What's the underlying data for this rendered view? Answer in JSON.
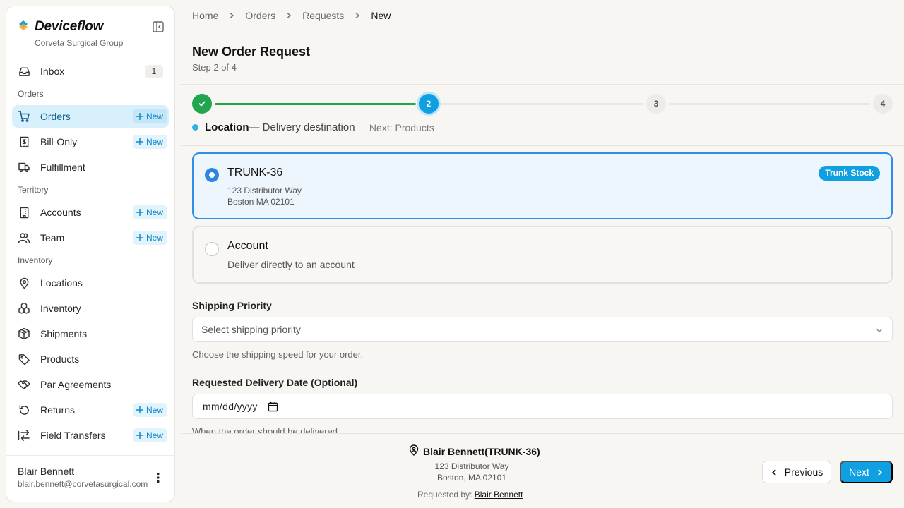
{
  "brand": {
    "name": "Deviceflow",
    "org": "Corveta Surgical Group",
    "accent": "#0ea0e0"
  },
  "sidebar": {
    "inbox": {
      "label": "Inbox",
      "count": "1"
    },
    "sections": {
      "orders": "Orders",
      "territory": "Territory",
      "inventory": "Inventory"
    },
    "new_label": "New",
    "items": {
      "orders": "Orders",
      "bill_only": "Bill-Only",
      "fulfillment": "Fulfillment",
      "accounts": "Accounts",
      "team": "Team",
      "locations": "Locations",
      "inventory": "Inventory",
      "shipments": "Shipments",
      "products": "Products",
      "par_agreements": "Par Agreements",
      "returns": "Returns",
      "field_transfers": "Field Transfers"
    },
    "user": {
      "name": "Blair Bennett",
      "email": "blair.bennett@corvetasurgical.com"
    }
  },
  "breadcrumb": [
    "Home",
    "Orders",
    "Requests",
    "New"
  ],
  "page": {
    "title": "New Order Request",
    "step": "Step 2 of 4"
  },
  "stepper": {
    "steps": [
      "1",
      "2",
      "3",
      "4"
    ],
    "current": 2,
    "caption_title": "Location",
    "caption_desc": "— Delivery destination",
    "caption_sep": "·",
    "caption_next": "Next: Products"
  },
  "options": {
    "trunk": {
      "title": "TRUNK-36",
      "line1": "123 Distributor Way",
      "line2": "Boston MA 02101",
      "badge": "Trunk Stock",
      "selected": true
    },
    "account": {
      "title": "Account",
      "desc": "Deliver directly to an account",
      "selected": false
    }
  },
  "shipping": {
    "label": "Shipping Priority",
    "placeholder": "Select shipping priority",
    "help": "Choose the shipping speed for your order."
  },
  "delivery_date": {
    "label": "Requested Delivery Date (Optional)",
    "value": "mm/dd/yyyy",
    "help": "When the order should be delivered"
  },
  "footer": {
    "ship_to": "Blair Bennett(TRUNK-36)",
    "addr1": "123 Distributor Way",
    "addr2": "Boston, MA 02101",
    "requested_by_label": "Requested by:",
    "requested_by": "Blair Bennett",
    "prev_label": "Previous",
    "next_label": "Next"
  }
}
